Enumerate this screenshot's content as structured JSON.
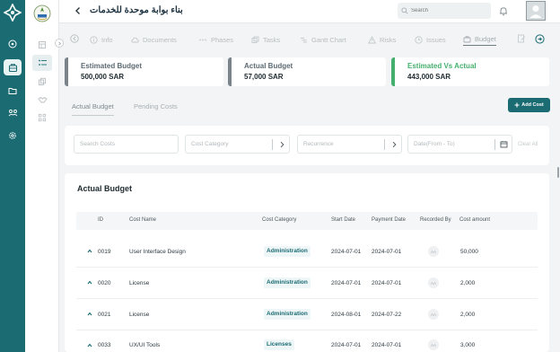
{
  "app": {
    "title": "بناء بوابة موحدة للخدمات",
    "search_placeholder": "Search",
    "avatar_icon": "user-silhouette-icon",
    "accent": "#1b6b72",
    "success": "#45b06e"
  },
  "rail_icons": [
    "home-icon",
    "budget-box-icon",
    "folder-icon",
    "team-icon",
    "settings-icon"
  ],
  "side_icons": [
    "board-icon",
    "list-icon",
    "copy-icon",
    "handshake-icon",
    "hierarchy-icon"
  ],
  "tabs": [
    {
      "label": "Info",
      "icon": "info-icon"
    },
    {
      "label": "Documents",
      "icon": "cloud-icon"
    },
    {
      "label": "Phases",
      "icon": "dots-icon"
    },
    {
      "label": "Tasks",
      "icon": "tasks-icon"
    },
    {
      "label": "Gantt Chart",
      "icon": "gantt-icon"
    },
    {
      "label": "Risks",
      "icon": "warning-icon"
    },
    {
      "label": "Issues",
      "icon": "clock-icon"
    },
    {
      "label": "Budget",
      "icon": "bag-icon",
      "active": true
    }
  ],
  "summary": {
    "estimated": {
      "label": "Estimated Budget",
      "value": "500,000 SAR"
    },
    "actual": {
      "label": "Actual Budget",
      "value": "57,000 SAR"
    },
    "vs": {
      "label": "Estimated Vs Actual",
      "value": "443,000 SAR"
    }
  },
  "subtabs": {
    "actual": "Actual Budget",
    "pending": "Pending Costs"
  },
  "add_cost": "Add Cost",
  "filters": {
    "search_placeholder": "Search Costs",
    "category_placeholder": "Cost Category",
    "recurrence_placeholder": "Recurrence",
    "date_placeholder": "Date(From - To)",
    "clear": "Clear All"
  },
  "table": {
    "title": "Actual Budget",
    "headers": {
      "id": "ID",
      "name": "Cost Name",
      "category": "Cost Category",
      "start": "Start Date",
      "payment": "Payment Date",
      "recorded": "Recorded By",
      "amount": "Cost amount"
    },
    "rows": [
      {
        "id": "0019",
        "name": "User Interface Design",
        "category": "Administration",
        "start": "2024-07-01",
        "payment": "2024-07-01",
        "recorded": "AA",
        "amount": "50,000"
      },
      {
        "id": "0020",
        "name": "License",
        "category": "Administration",
        "start": "2024-07-01",
        "payment": "2024-07-01",
        "recorded": "AA",
        "amount": "2,000"
      },
      {
        "id": "0021",
        "name": "License",
        "category": "Administration",
        "start": "2024-08-01",
        "payment": "2024-07-22",
        "recorded": "AA",
        "amount": "2,000"
      },
      {
        "id": "0033",
        "name": "UX/UI Tools",
        "category": "Licenses",
        "start": "2024-07-01",
        "payment": "2024-07-01",
        "recorded": "AA",
        "amount": "3,000"
      }
    ]
  }
}
